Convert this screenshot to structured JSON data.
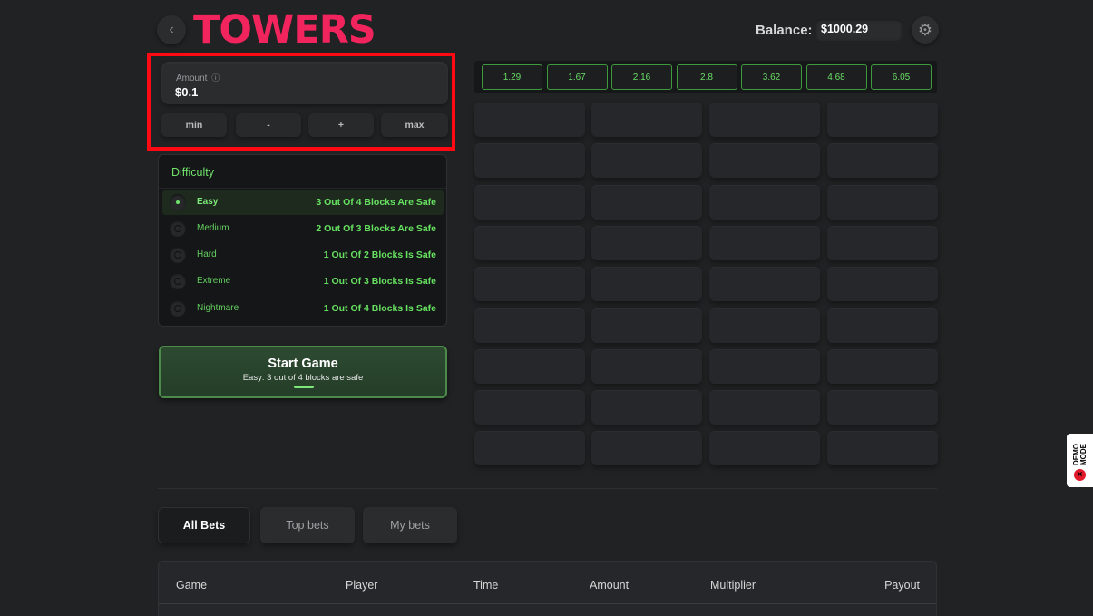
{
  "header": {
    "logo_text": "TOWERS",
    "back_icon": "chevron-left-icon",
    "balance_label": "Balance:",
    "balance_value": "$1000.29",
    "settings_icon": "gear-icon"
  },
  "amount": {
    "label": "Amount",
    "info_icon": "ⓘ",
    "value": "$0.1",
    "buttons": {
      "min": "min",
      "minus": "-",
      "plus": "+",
      "max": "max"
    }
  },
  "difficulty": {
    "title": "Difficulty",
    "options": [
      {
        "name": "Easy",
        "desc": "3 Out Of 4 Blocks Are Safe",
        "selected": true
      },
      {
        "name": "Medium",
        "desc": "2 Out Of 3 Blocks Are Safe",
        "selected": false
      },
      {
        "name": "Hard",
        "desc": "1 Out Of 2 Blocks Is Safe",
        "selected": false
      },
      {
        "name": "Extreme",
        "desc": "1 Out Of 3 Blocks Is Safe",
        "selected": false
      },
      {
        "name": "Nightmare",
        "desc": "1 Out Of 4 Blocks Is Safe",
        "selected": false
      }
    ]
  },
  "start": {
    "title": "Start Game",
    "subtitle": "Easy: 3 out of 4 blocks are safe"
  },
  "multipliers": [
    "1.29",
    "1.67",
    "2.16",
    "2.8",
    "3.62",
    "4.68",
    "6.05"
  ],
  "grid": {
    "rows": 9,
    "cols": 4
  },
  "demo_badge": {
    "text": "DEMO MODE",
    "icon": "close-x-icon"
  },
  "bets": {
    "tabs": [
      "All Bets",
      "Top bets",
      "My bets"
    ],
    "active_tab": "All Bets",
    "columns": [
      "Game",
      "Player",
      "Time",
      "Amount",
      "Multiplier",
      "Payout"
    ]
  },
  "colors": {
    "accent_green": "#6bde66",
    "logo_pink": "#f2245e",
    "highlight_red": "#ff0a12",
    "background": "#202223"
  }
}
